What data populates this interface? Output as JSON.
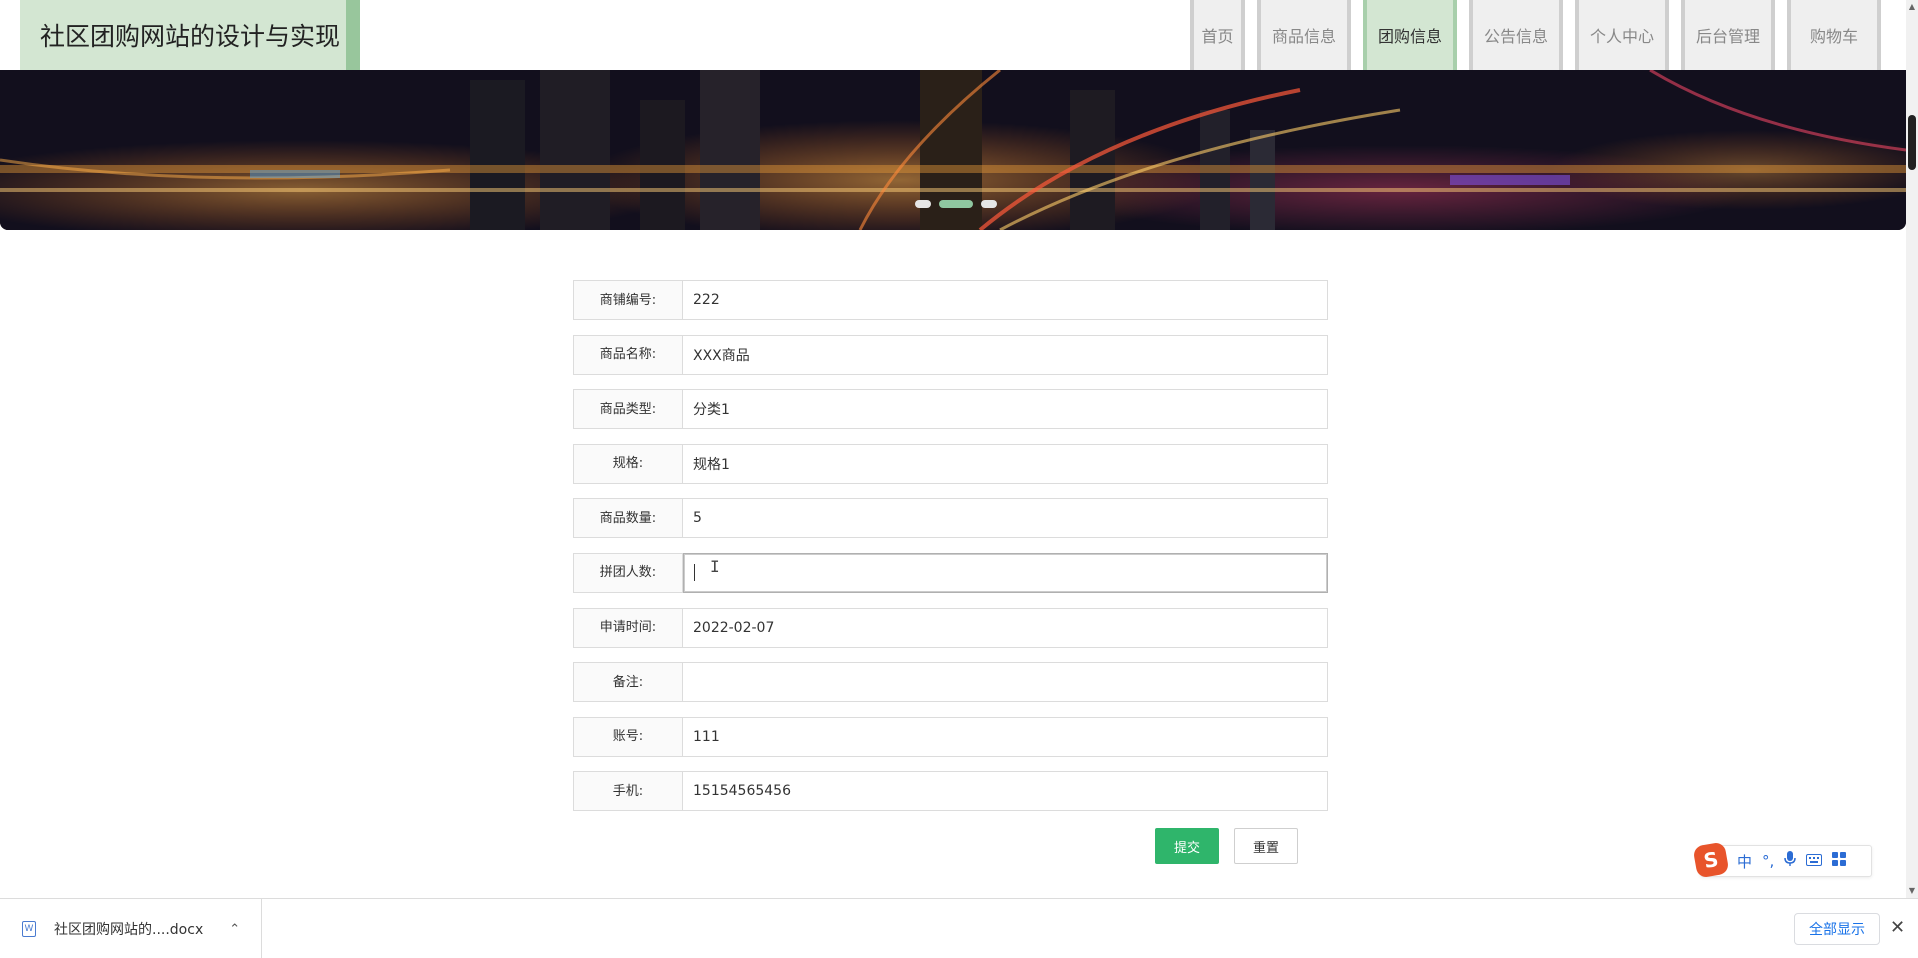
{
  "header": {
    "site_title": "社区团购网站的设计与实现",
    "nav": [
      {
        "label": "首页",
        "active": false
      },
      {
        "label": "商品信息",
        "active": false
      },
      {
        "label": "团购信息",
        "active": true
      },
      {
        "label": "公告信息",
        "active": false
      },
      {
        "label": "个人中心",
        "active": false
      },
      {
        "label": "后台管理",
        "active": false
      },
      {
        "label": "购物车",
        "active": false
      }
    ]
  },
  "banner": {
    "slide_count": 3,
    "active_slide": 2
  },
  "form": {
    "fields": [
      {
        "label": "商铺编号:",
        "value": "222"
      },
      {
        "label": "商品名称:",
        "value": "XXX商品"
      },
      {
        "label": "商品类型:",
        "value": "分类1"
      },
      {
        "label": "规格:",
        "value": "规格1"
      },
      {
        "label": "商品数量:",
        "value": "5"
      },
      {
        "label": "拼团人数:",
        "value": ""
      },
      {
        "label": "申请时间:",
        "value": "2022-02-07"
      },
      {
        "label": "备注:",
        "value": ""
      },
      {
        "label": "账号:",
        "value": "111"
      },
      {
        "label": "手机:",
        "value": "15154565456"
      }
    ],
    "submit_label": "提交",
    "reset_label": "重置"
  },
  "ime": {
    "logo": "S",
    "mode": "中",
    "punct": "°,",
    "icons": [
      "microphone-icon",
      "keyboard-icon",
      "grid-icon"
    ]
  },
  "download_bar": {
    "file_name": "社区团购网站的....docx",
    "show_all_label": "全部显示"
  },
  "colors": {
    "logo_bg": "#d3e6d2",
    "logo_accent": "#98c69c",
    "nav_active_bg": "#d3e6d2",
    "submit_bg": "#2fb56b",
    "link_blue": "#1a73e8"
  }
}
